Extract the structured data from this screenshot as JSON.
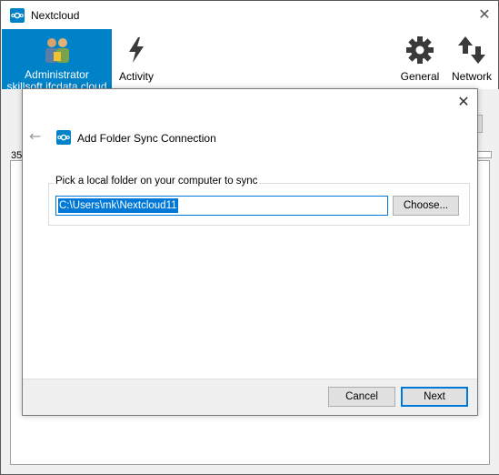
{
  "window": {
    "title": "Nextcloud",
    "close_glyph": "✕",
    "app_icon": "nextcloud-logo-icon"
  },
  "toolbar": {
    "account_label": "Administrator skillsoft.ifcdata.cloud",
    "activity_label": "Activity",
    "general_label": "General",
    "network_label": "Network"
  },
  "background": {
    "partial_text": "35"
  },
  "dialog": {
    "title": "Add Folder Sync Connection",
    "close_glyph": "✕",
    "back_glyph": "←",
    "group_label": "Pick a local folder on your computer to sync",
    "local_path": "C:\\Users\\mk\\Nextcloud11",
    "choose_label": "Choose...",
    "cancel_label": "Cancel",
    "next_label": "Next"
  },
  "colors": {
    "accent": "#0082c9",
    "selection": "#0078d7",
    "face": "#f0f0f0"
  }
}
